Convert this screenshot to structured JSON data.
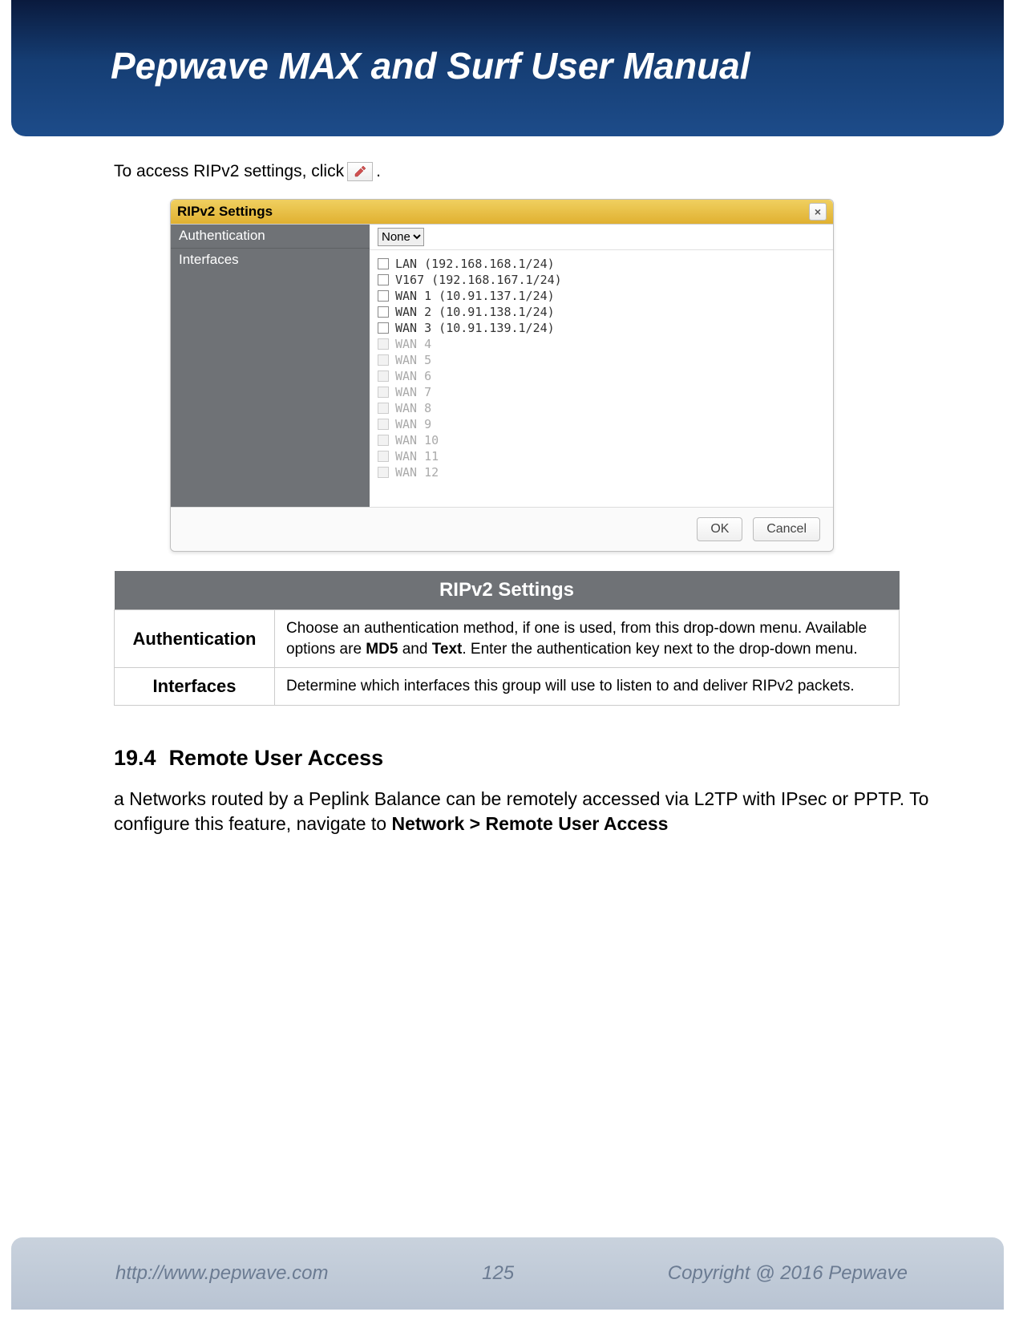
{
  "document": {
    "title": "Pepwave MAX and Surf User Manual"
  },
  "intro": {
    "prefix": "To access RIPv2 settings, click ",
    "suffix": "."
  },
  "dialog": {
    "title": "RIPv2 Settings",
    "labels": {
      "authentication": "Authentication",
      "interfaces": "Interfaces"
    },
    "auth_selected": "None",
    "interfaces": [
      {
        "label": "LAN (192.168.168.1/24)",
        "enabled": true
      },
      {
        "label": "V167 (192.168.167.1/24)",
        "enabled": true
      },
      {
        "label": "WAN 1 (10.91.137.1/24)",
        "enabled": true
      },
      {
        "label": "WAN 2 (10.91.138.1/24)",
        "enabled": true
      },
      {
        "label": "WAN 3 (10.91.139.1/24)",
        "enabled": true
      },
      {
        "label": "WAN 4",
        "enabled": false
      },
      {
        "label": "WAN 5",
        "enabled": false
      },
      {
        "label": "WAN 6",
        "enabled": false
      },
      {
        "label": "WAN 7",
        "enabled": false
      },
      {
        "label": "WAN 8",
        "enabled": false
      },
      {
        "label": "WAN 9",
        "enabled": false
      },
      {
        "label": "WAN 10",
        "enabled": false
      },
      {
        "label": "WAN 11",
        "enabled": false
      },
      {
        "label": "WAN 12",
        "enabled": false
      }
    ],
    "buttons": {
      "ok": "OK",
      "cancel": "Cancel",
      "close": "×"
    }
  },
  "settings_table": {
    "header": "RIPv2 Settings",
    "rows": [
      {
        "label": "Authentication",
        "desc_parts": [
          "Choose an authentication method, if one is used, from this drop-down menu. Available options are ",
          "MD5",
          " and ",
          "Text",
          ". Enter the authentication key next to the drop-down menu."
        ]
      },
      {
        "label": "Interfaces",
        "desc": "Determine which interfaces this group will use to listen to and deliver RIPv2 packets."
      }
    ]
  },
  "section": {
    "number": "19.4",
    "title": "Remote User Access",
    "body_parts": [
      "a Networks routed by a Peplink Balance can be remotely accessed via L2TP with IPsec or PPTP. To configure this feature, navigate to ",
      "Network > Remote User Access"
    ]
  },
  "footer": {
    "url": "http://www.pepwave.com",
    "page": "125",
    "copyright": "Copyright @ 2016 Pepwave"
  }
}
